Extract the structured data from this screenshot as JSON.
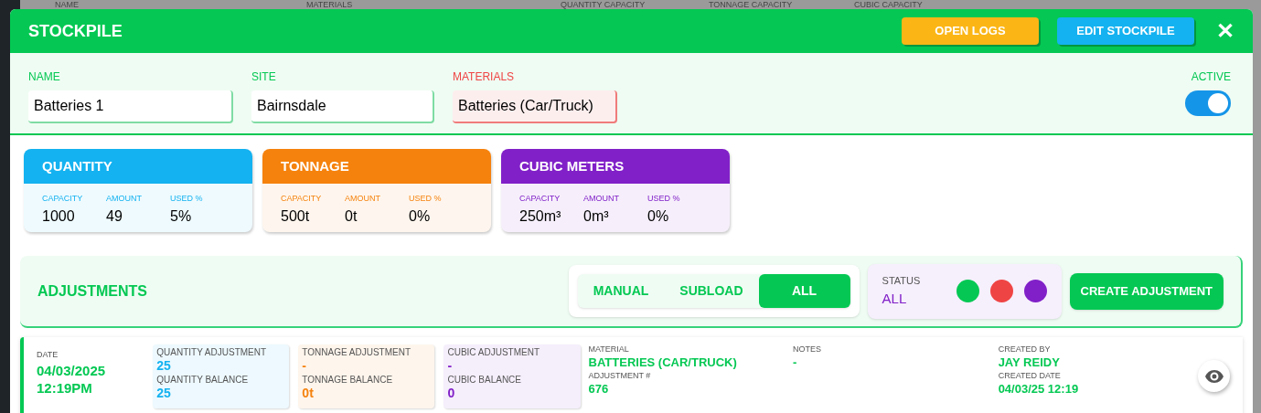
{
  "background_table": {
    "columns": [
      "NAME",
      "MATERIALS",
      "QUANTITY CAPACITY",
      "TONNAGE CAPACITY",
      "CUBIC CAPACITY"
    ]
  },
  "modal": {
    "title": "STOCKPILE",
    "buttons": [
      {
        "label": "OPEN LOGS",
        "kind": "logs"
      },
      {
        "label": "EDIT STOCKPILE",
        "kind": "edit"
      }
    ],
    "close": "✕"
  },
  "fields": [
    {
      "label": "NAME",
      "value": "Batteries 1",
      "invalid": false
    },
    {
      "label": "SITE",
      "value": "Bairnsdale",
      "invalid": false
    },
    {
      "label": "MATERIALS",
      "value": "Batteries (Car/Truck)",
      "invalid": true
    }
  ],
  "active": {
    "label": "ACTIVE",
    "on": true
  },
  "stats": [
    {
      "title": "QUANTITY",
      "color": "#14b2f0",
      "items": [
        {
          "label": "CAPACITY",
          "value": "1000"
        },
        {
          "label": "AMOUNT",
          "value": "49"
        },
        {
          "label": "USED %",
          "value": "5%"
        }
      ]
    },
    {
      "title": "TONNAGE",
      "color": "#f5820d",
      "items": [
        {
          "label": "CAPACITY",
          "value": "500t"
        },
        {
          "label": "AMOUNT",
          "value": "0t"
        },
        {
          "label": "USED %",
          "value": "0%"
        }
      ]
    },
    {
      "title": "CUBIC METERS",
      "color": "#8120c8",
      "items": [
        {
          "label": "CAPACITY",
          "value": "250m³"
        },
        {
          "label": "AMOUNT",
          "value": "0m³"
        },
        {
          "label": "USED %",
          "value": "0%"
        }
      ]
    }
  ],
  "adjustments": {
    "title": "ADJUSTMENTS",
    "filters": [
      {
        "label": "MANUAL",
        "selected": false
      },
      {
        "label": "SUBLOAD",
        "selected": false
      },
      {
        "label": "ALL",
        "selected": true
      }
    ],
    "status": {
      "label": "STATUS",
      "value": "ALL",
      "dots": [
        {
          "color": "#04c853"
        },
        {
          "color": "#ef4444"
        },
        {
          "color": "#8120c8"
        }
      ]
    },
    "create_button": "CREATE ADJUSTMENT",
    "rows": [
      {
        "date_label": "DATE",
        "date": "04/03/2025",
        "time": "12:19PM",
        "boxes": [
          {
            "color": "#14b2f0",
            "items": [
              {
                "label": "QUANTITY ADJUSTMENT",
                "value": "25"
              },
              {
                "label": "QUANTITY BALANCE",
                "value": "25"
              }
            ]
          },
          {
            "color": "#f5820d",
            "items": [
              {
                "label": "TONNAGE ADJUSTMENT",
                "value": "-"
              },
              {
                "label": "TONNAGE BALANCE",
                "value": "0t"
              }
            ]
          },
          {
            "color": "#8120c8",
            "items": [
              {
                "label": "CUBIC ADJUSTMENT",
                "value": "-"
              },
              {
                "label": "CUBIC BALANCE",
                "value": "0"
              }
            ]
          }
        ],
        "details": [
          [
            {
              "label": "MATERIAL",
              "value": "BATTERIES (CAR/TRUCK)"
            },
            {
              "label": "ADJUSTMENT #",
              "value": "676"
            }
          ],
          [
            {
              "label": "NOTES",
              "value": "-"
            }
          ],
          [
            {
              "label": "CREATED BY",
              "value": "JAY REIDY"
            },
            {
              "label": "CREATED DATE",
              "value": "04/03/25 12:19"
            }
          ]
        ]
      }
    ]
  }
}
